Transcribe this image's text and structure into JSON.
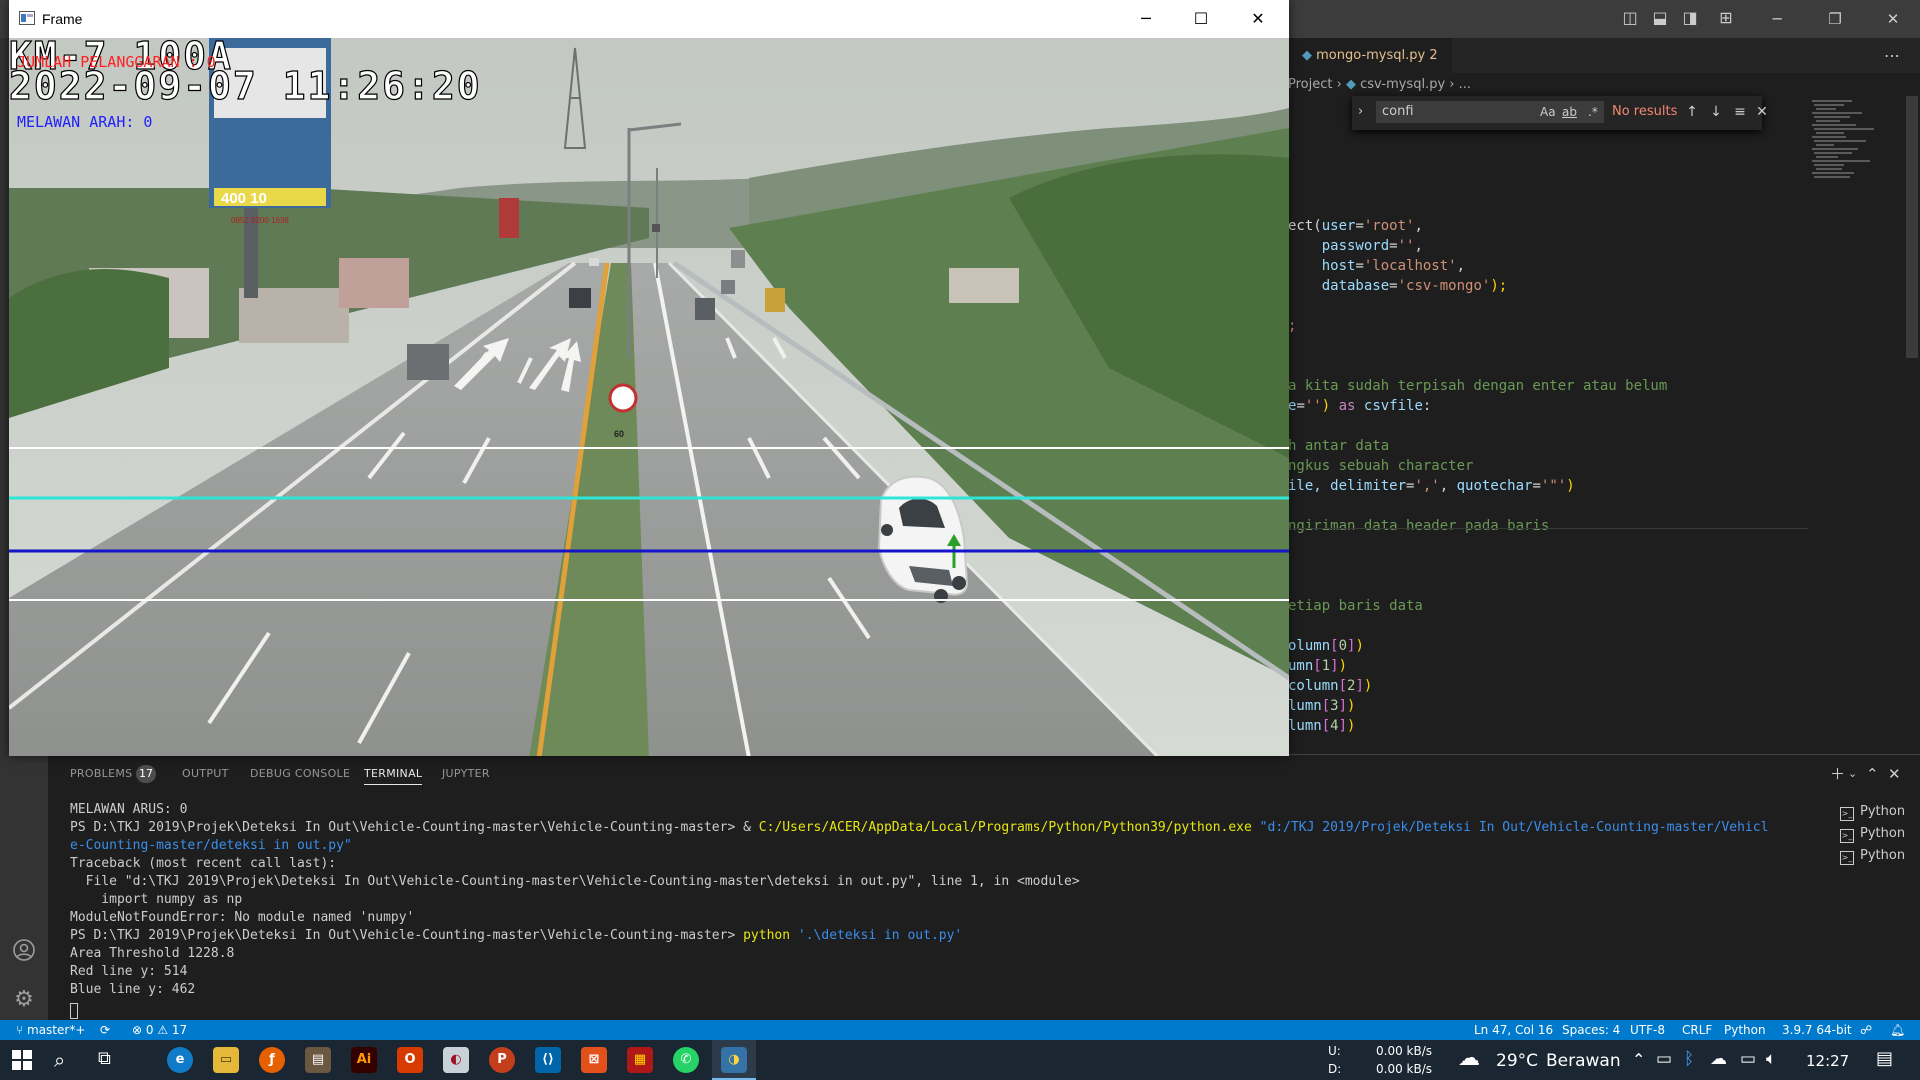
{
  "vscode": {
    "tab_file": "mongo-mysql.py",
    "tab_badge": "2",
    "breadcrumb": [
      "Project",
      "csv-mysql.py",
      "..."
    ],
    "find": {
      "query": "confi",
      "opt_case": "Aa",
      "opt_word": "ab",
      "opt_regex": ".*",
      "result": "No results"
    },
    "code_lines": [
      [
        {
          "t": "ect(",
          "c": "#d4d4d4"
        },
        {
          "t": "user",
          "c": "#9cdcfe"
        },
        {
          "t": "=",
          "c": "#d4d4d4"
        },
        {
          "t": "'root'",
          "c": "#ce9178"
        },
        {
          "t": ",",
          "c": "#d4d4d4"
        }
      ],
      [
        {
          "t": "    password",
          "c": "#9cdcfe"
        },
        {
          "t": "=",
          "c": "#d4d4d4"
        },
        {
          "t": "''",
          "c": "#ce9178"
        },
        {
          "t": ",",
          "c": "#d4d4d4"
        }
      ],
      [
        {
          "t": "    host",
          "c": "#9cdcfe"
        },
        {
          "t": "=",
          "c": "#d4d4d4"
        },
        {
          "t": "'localhost'",
          "c": "#ce9178"
        },
        {
          "t": ",",
          "c": "#d4d4d4"
        }
      ],
      [
        {
          "t": "    database",
          "c": "#9cdcfe"
        },
        {
          "t": "=",
          "c": "#d4d4d4"
        },
        {
          "t": "'csv-mongo'",
          "c": "#ce9178"
        },
        {
          "t": ");",
          "c": "#ffd700"
        }
      ],
      [
        {
          "t": "",
          "c": "#d4d4d4"
        }
      ],
      [
        {
          "t": ";",
          "c": "#ce9178"
        }
      ],
      [
        {
          "t": "",
          "c": "#d4d4d4"
        }
      ],
      [
        {
          "t": "",
          "c": "#d4d4d4"
        }
      ],
      [
        {
          "t": "a kita sudah terpisah dengan enter atau belum",
          "c": "#6a9955"
        }
      ],
      [
        {
          "t": "e",
          "c": "#9cdcfe"
        },
        {
          "t": "=",
          "c": "#d4d4d4"
        },
        {
          "t": "''",
          "c": "#ce9178"
        },
        {
          "t": ")",
          "c": "#ffd700"
        },
        {
          "t": " as ",
          "c": "#c586c0"
        },
        {
          "t": "csvfile",
          "c": "#9cdcfe"
        },
        {
          "t": ":",
          "c": "#d4d4d4"
        }
      ],
      [
        {
          "t": "",
          "c": "#d4d4d4"
        }
      ],
      [
        {
          "t": "h antar data",
          "c": "#6a9955"
        }
      ],
      [
        {
          "t": "ngkus sebuah character",
          "c": "#6a9955"
        }
      ],
      [
        {
          "t": "ile, ",
          "c": "#9cdcfe"
        },
        {
          "t": "delimiter",
          "c": "#9cdcfe"
        },
        {
          "t": "=",
          "c": "#d4d4d4"
        },
        {
          "t": "','",
          "c": "#ce9178"
        },
        {
          "t": ", ",
          "c": "#d4d4d4"
        },
        {
          "t": "quotechar",
          "c": "#9cdcfe"
        },
        {
          "t": "=",
          "c": "#d4d4d4"
        },
        {
          "t": "'\"'",
          "c": "#ce9178"
        },
        {
          "t": ")",
          "c": "#ffd700"
        }
      ],
      [
        {
          "t": "",
          "c": "#d4d4d4"
        }
      ],
      [
        {
          "t": "ngiriman data header pada baris",
          "c": "#6a9955"
        }
      ],
      [
        {
          "t": "",
          "c": "#d4d4d4"
        }
      ],
      [
        {
          "t": "",
          "c": "#d4d4d4"
        }
      ],
      [
        {
          "t": "",
          "c": "#d4d4d4"
        }
      ],
      [
        {
          "t": "etiap baris data",
          "c": "#6a9955"
        }
      ],
      [
        {
          "t": "",
          "c": "#d4d4d4"
        }
      ],
      [
        {
          "t": "olumn",
          "c": "#9cdcfe"
        },
        {
          "t": "[",
          "c": "#da70d6"
        },
        {
          "t": "0",
          "c": "#b5cea8"
        },
        {
          "t": "]",
          "c": "#da70d6"
        },
        {
          "t": ")",
          "c": "#ffd700"
        }
      ],
      [
        {
          "t": "umn",
          "c": "#9cdcfe"
        },
        {
          "t": "[",
          "c": "#da70d6"
        },
        {
          "t": "1",
          "c": "#b5cea8"
        },
        {
          "t": "]",
          "c": "#da70d6"
        },
        {
          "t": ")",
          "c": "#ffd700"
        }
      ],
      [
        {
          "t": "column",
          "c": "#9cdcfe"
        },
        {
          "t": "[",
          "c": "#da70d6"
        },
        {
          "t": "2",
          "c": "#b5cea8"
        },
        {
          "t": "]",
          "c": "#da70d6"
        },
        {
          "t": ")",
          "c": "#ffd700"
        }
      ],
      [
        {
          "t": "lumn",
          "c": "#9cdcfe"
        },
        {
          "t": "[",
          "c": "#da70d6"
        },
        {
          "t": "3",
          "c": "#b5cea8"
        },
        {
          "t": "]",
          "c": "#da70d6"
        },
        {
          "t": ")",
          "c": "#ffd700"
        }
      ],
      [
        {
          "t": "lumn",
          "c": "#9cdcfe"
        },
        {
          "t": "[",
          "c": "#da70d6"
        },
        {
          "t": "4",
          "c": "#b5cea8"
        },
        {
          "t": "]",
          "c": "#da70d6"
        },
        {
          "t": ")",
          "c": "#ffd700"
        }
      ]
    ]
  },
  "panel": {
    "tabs": [
      "PROBLEMS",
      "OUTPUT",
      "DEBUG CONSOLE",
      "TERMINAL",
      "JUPYTER"
    ],
    "problems_count": "17",
    "active_tab": "TERMINAL",
    "terminal_lines": [
      [
        {
          "t": "MELAWAN ARUS: 0",
          "c": "#cccccc"
        }
      ],
      [
        {
          "t": "PS D:\\TKJ 2019\\Projek\\Deteksi In Out\\Vehicle-Counting-master\\Vehicle-Counting-master> & ",
          "c": "#cccccc"
        },
        {
          "t": "C:/Users/ACER/AppData/Local/Programs/Python/Python39/python.exe",
          "c": "#e5e510"
        },
        {
          "t": " \"d:/TKJ 2019/Projek/Deteksi In Out/Vehicle-Counting-master/Vehicl",
          "c": "#3b8eea"
        }
      ],
      [
        {
          "t": "e-Counting-master/deteksi in out.py\"",
          "c": "#3b8eea"
        }
      ],
      [
        {
          "t": "Traceback (most recent call last):",
          "c": "#cccccc"
        }
      ],
      [
        {
          "t": "  File \"d:\\TKJ 2019\\Projek\\Deteksi In Out\\Vehicle-Counting-master\\Vehicle-Counting-master\\deteksi in out.py\", line 1, in <module>",
          "c": "#cccccc"
        }
      ],
      [
        {
          "t": "    import numpy as np",
          "c": "#cccccc"
        }
      ],
      [
        {
          "t": "ModuleNotFoundError: No module named 'numpy'",
          "c": "#cccccc"
        }
      ],
      [
        {
          "t": "PS D:\\TKJ 2019\\Projek\\Deteksi In Out\\Vehicle-Counting-master\\Vehicle-Counting-master> ",
          "c": "#cccccc"
        },
        {
          "t": "python",
          "c": "#e5e510"
        },
        {
          "t": " '.\\deteksi in out.py'",
          "c": "#3b8eea"
        }
      ],
      [
        {
          "t": "Area Threshold 1228.8",
          "c": "#cccccc"
        }
      ],
      [
        {
          "t": "Red line y: 514",
          "c": "#cccccc"
        }
      ],
      [
        {
          "t": "Blue line y: 462",
          "c": "#cccccc"
        }
      ]
    ],
    "terminals": [
      "Python",
      "Python",
      "Python"
    ]
  },
  "statusbar": {
    "branch": "master*+",
    "errors": "0",
    "warnings": "17",
    "position": "Ln 47, Col 16",
    "spaces": "Spaces: 4",
    "encoding": "UTF-8",
    "eol": "CRLF",
    "language": "Python",
    "interpreter": "3.9.7 64-bit"
  },
  "frame": {
    "title": "Frame",
    "overlay_location": "KM-7 100A",
    "overlay_violations": "JUMLAH PELANGGARAN : 0",
    "overlay_datetime": "2022-09-07 11:26:20",
    "overlay_wrong_way": "MELAWAN ARAH: 0",
    "billboard_text": "400 10",
    "billboard_phone": "0851 9200 1638",
    "speed_sign": "60"
  },
  "taskbar": {
    "net_up_label": "U:",
    "net_down_label": "D:",
    "net_up": "0.00 kB/s",
    "net_down": "0.00 kB/s",
    "temperature": "29°C",
    "weather": "Berawan",
    "clock": "12:27"
  },
  "colors": {
    "vscode_bg": "#1e1e1e",
    "statusbar": "#007acc",
    "taskbar": "#1b2633",
    "line_cyan": "#2ee6d8",
    "line_blue": "#1414c8"
  }
}
